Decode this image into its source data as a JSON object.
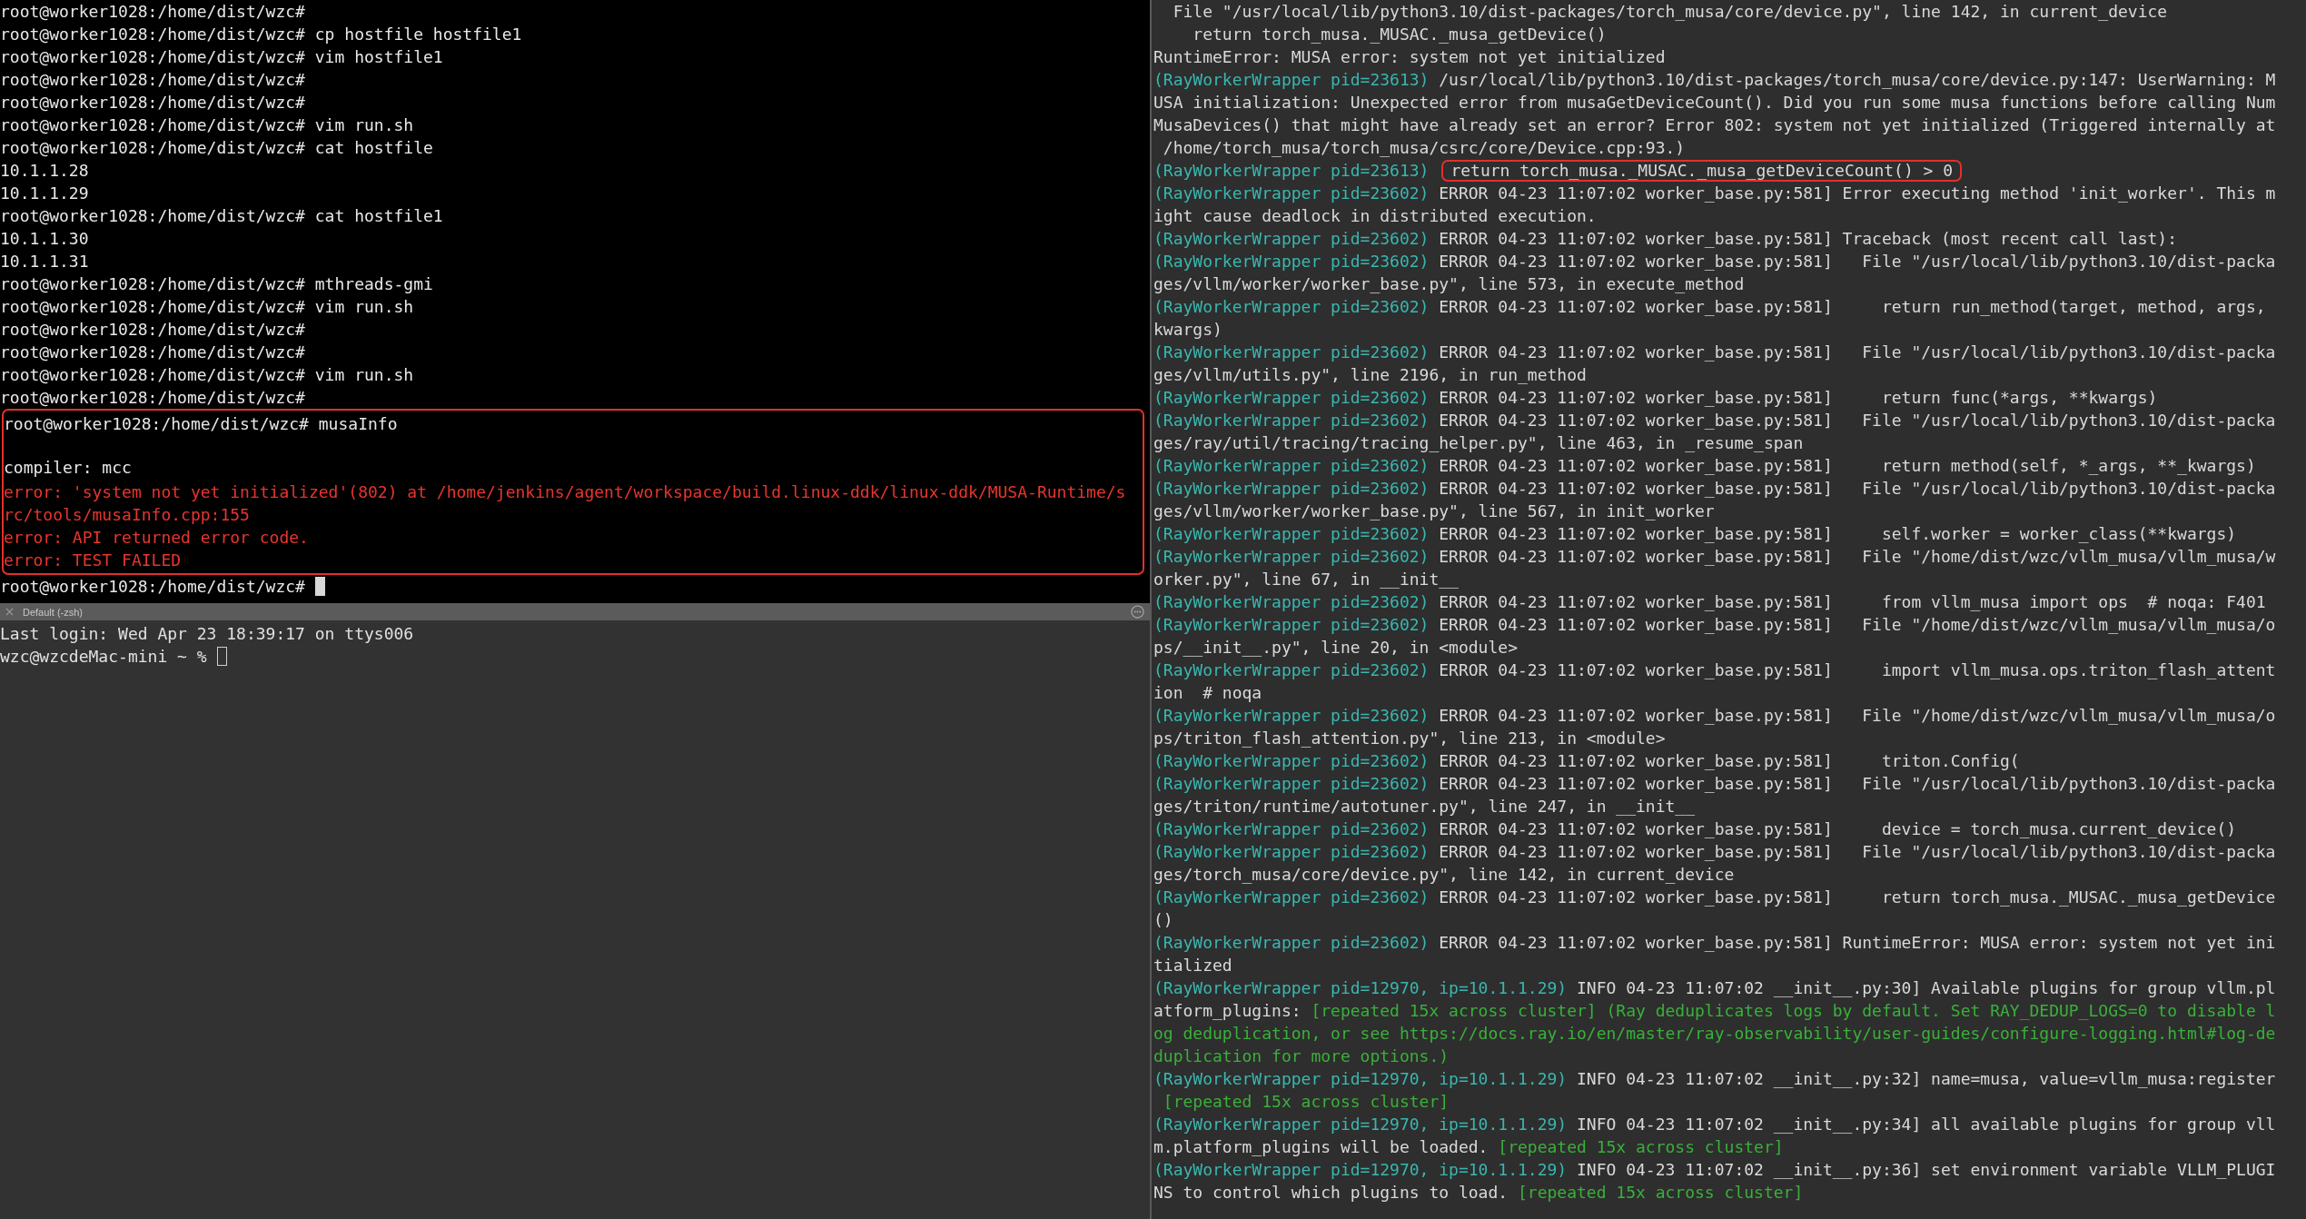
{
  "left": {
    "top_pane": {
      "focused": true,
      "blocks": [
        {
          "highlighted": false,
          "lines": [
            {
              "text": "root@worker1028:/home/dist/wzc#",
              "error": false
            },
            {
              "text": "root@worker1028:/home/dist/wzc# cp hostfile hostfile1",
              "error": false
            },
            {
              "text": "root@worker1028:/home/dist/wzc# vim hostfile1",
              "error": false
            },
            {
              "text": "root@worker1028:/home/dist/wzc#",
              "error": false
            },
            {
              "text": "root@worker1028:/home/dist/wzc#",
              "error": false
            },
            {
              "text": "root@worker1028:/home/dist/wzc# vim run.sh",
              "error": false
            },
            {
              "text": "root@worker1028:/home/dist/wzc# cat hostfile",
              "error": false
            },
            {
              "text": "10.1.1.28",
              "error": false
            },
            {
              "text": "10.1.1.29",
              "error": false
            },
            {
              "text": "root@worker1028:/home/dist/wzc# cat hostfile1",
              "error": false
            },
            {
              "text": "10.1.1.30",
              "error": false
            },
            {
              "text": "10.1.1.31",
              "error": false
            },
            {
              "text": "root@worker1028:/home/dist/wzc# mthreads-gmi",
              "error": false
            },
            {
              "text": "root@worker1028:/home/dist/wzc# vim run.sh",
              "error": false
            },
            {
              "text": "root@worker1028:/home/dist/wzc#",
              "error": false
            },
            {
              "text": "root@worker1028:/home/dist/wzc#",
              "error": false
            },
            {
              "text": "root@worker1028:/home/dist/wzc# vim run.sh",
              "error": false
            },
            {
              "text": "root@worker1028:/home/dist/wzc#",
              "error": false
            }
          ]
        },
        {
          "highlighted": true,
          "lines": [
            {
              "text": "root@worker1028:/home/dist/wzc# musaInfo",
              "error": false
            },
            {
              "text": "compiler: mcc",
              "error": false,
              "blank_line_before": true
            },
            {
              "text": "error: 'system not yet initialized'(802) at /home/jenkins/agent/workspace/build.linux-ddk/linux-ddk/MUSA-Runtime/s",
              "error": true
            },
            {
              "text": "rc/tools/musaInfo.cpp:155",
              "error": true
            },
            {
              "text": "error: API returned error code.",
              "error": true
            },
            {
              "text": "error: TEST FAILED",
              "error": true
            }
          ]
        },
        {
          "highlighted": false,
          "lines": [
            {
              "text": "root@worker1028:/home/dist/wzc#",
              "error": false,
              "cursor": true
            }
          ]
        }
      ]
    },
    "bottom_pane": {
      "focused": false,
      "tab_title": "Default (-zsh)",
      "lines": [
        {
          "text": "Last login: Wed Apr 23 18:39:17 on ttys006",
          "error": false
        },
        {
          "text": "wzc@wzcdeMac-mini ~ %",
          "error": false,
          "cursor": true
        }
      ]
    }
  },
  "right_pane": {
    "rows": [
      [
        {
          "kind": "plain",
          "text": "  File \"/usr/local/lib/python3.10/dist-packages/torch_musa/core/device.py\", line 142, in current_device"
        }
      ],
      [
        {
          "kind": "plain",
          "text": "    return torch_musa._MUSAC._musa_getDevice()"
        }
      ],
      [
        {
          "kind": "plain",
          "text": "RuntimeError: MUSA error: system not yet initialized"
        }
      ],
      [
        {
          "kind": "worker",
          "text": "(RayWorkerWrapper pid=23613)"
        },
        {
          "kind": "plain",
          "text": " /usr/local/lib/python3.10/dist-packages/torch_musa/core/device.py:147: UserWarning: M"
        }
      ],
      [
        {
          "kind": "plain",
          "text": "USA initialization: Unexpected error from musaGetDeviceCount(). Did you run some musa functions before calling Num"
        }
      ],
      [
        {
          "kind": "plain",
          "text": "MusaDevices() that might have already set an error? Error 802: system not yet initialized (Triggered internally at"
        }
      ],
      [
        {
          "kind": "plain",
          "text": " /home/torch_musa/torch_musa/csrc/core/Device.cpp:93.)"
        }
      ],
      [
        {
          "kind": "worker",
          "text": "(RayWorkerWrapper pid=23613)"
        },
        {
          "kind": "boxed",
          "text": "return torch_musa._MUSAC._musa_getDeviceCount() > 0"
        }
      ],
      [
        {
          "kind": "worker",
          "text": "(RayWorkerWrapper pid=23602)"
        },
        {
          "kind": "plain",
          "text": " ERROR 04-23 11:07:02 worker_base.py:581] Error executing method 'init_worker'. This m"
        }
      ],
      [
        {
          "kind": "plain",
          "text": "ight cause deadlock in distributed execution."
        }
      ],
      [
        {
          "kind": "worker",
          "text": "(RayWorkerWrapper pid=23602)"
        },
        {
          "kind": "plain",
          "text": " ERROR 04-23 11:07:02 worker_base.py:581] Traceback (most recent call last):"
        }
      ],
      [
        {
          "kind": "worker",
          "text": "(RayWorkerWrapper pid=23602)"
        },
        {
          "kind": "plain",
          "text": " ERROR 04-23 11:07:02 worker_base.py:581]   File \"/usr/local/lib/python3.10/dist-packa"
        }
      ],
      [
        {
          "kind": "plain",
          "text": "ges/vllm/worker/worker_base.py\", line 573, in execute_method"
        }
      ],
      [
        {
          "kind": "worker",
          "text": "(RayWorkerWrapper pid=23602)"
        },
        {
          "kind": "plain",
          "text": " ERROR 04-23 11:07:02 worker_base.py:581]     return run_method(target, method, args,"
        }
      ],
      [
        {
          "kind": "plain",
          "text": "kwargs)"
        }
      ],
      [
        {
          "kind": "worker",
          "text": "(RayWorkerWrapper pid=23602)"
        },
        {
          "kind": "plain",
          "text": " ERROR 04-23 11:07:02 worker_base.py:581]   File \"/usr/local/lib/python3.10/dist-packa"
        }
      ],
      [
        {
          "kind": "plain",
          "text": "ges/vllm/utils.py\", line 2196, in run_method"
        }
      ],
      [
        {
          "kind": "worker",
          "text": "(RayWorkerWrapper pid=23602)"
        },
        {
          "kind": "plain",
          "text": " ERROR 04-23 11:07:02 worker_base.py:581]     return func(*args, **kwargs)"
        }
      ],
      [
        {
          "kind": "worker",
          "text": "(RayWorkerWrapper pid=23602)"
        },
        {
          "kind": "plain",
          "text": " ERROR 04-23 11:07:02 worker_base.py:581]   File \"/usr/local/lib/python3.10/dist-packa"
        }
      ],
      [
        {
          "kind": "plain",
          "text": "ges/ray/util/tracing/tracing_helper.py\", line 463, in _resume_span"
        }
      ],
      [
        {
          "kind": "worker",
          "text": "(RayWorkerWrapper pid=23602)"
        },
        {
          "kind": "plain",
          "text": " ERROR 04-23 11:07:02 worker_base.py:581]     return method(self, *_args, **_kwargs)"
        }
      ],
      [
        {
          "kind": "worker",
          "text": "(RayWorkerWrapper pid=23602)"
        },
        {
          "kind": "plain",
          "text": " ERROR 04-23 11:07:02 worker_base.py:581]   File \"/usr/local/lib/python3.10/dist-packa"
        }
      ],
      [
        {
          "kind": "plain",
          "text": "ges/vllm/worker/worker_base.py\", line 567, in init_worker"
        }
      ],
      [
        {
          "kind": "worker",
          "text": "(RayWorkerWrapper pid=23602)"
        },
        {
          "kind": "plain",
          "text": " ERROR 04-23 11:07:02 worker_base.py:581]     self.worker = worker_class(**kwargs)"
        }
      ],
      [
        {
          "kind": "worker",
          "text": "(RayWorkerWrapper pid=23602)"
        },
        {
          "kind": "plain",
          "text": " ERROR 04-23 11:07:02 worker_base.py:581]   File \"/home/dist/wzc/vllm_musa/vllm_musa/w"
        }
      ],
      [
        {
          "kind": "plain",
          "text": "orker.py\", line 67, in __init__"
        }
      ],
      [
        {
          "kind": "worker",
          "text": "(RayWorkerWrapper pid=23602)"
        },
        {
          "kind": "plain",
          "text": " ERROR 04-23 11:07:02 worker_base.py:581]     from vllm_musa import ops  # noqa: F401"
        }
      ],
      [
        {
          "kind": "worker",
          "text": "(RayWorkerWrapper pid=23602)"
        },
        {
          "kind": "plain",
          "text": " ERROR 04-23 11:07:02 worker_base.py:581]   File \"/home/dist/wzc/vllm_musa/vllm_musa/o"
        }
      ],
      [
        {
          "kind": "plain",
          "text": "ps/__init__.py\", line 20, in <module>"
        }
      ],
      [
        {
          "kind": "worker",
          "text": "(RayWorkerWrapper pid=23602)"
        },
        {
          "kind": "plain",
          "text": " ERROR 04-23 11:07:02 worker_base.py:581]     import vllm_musa.ops.triton_flash_attent"
        }
      ],
      [
        {
          "kind": "plain",
          "text": "ion  # noqa"
        }
      ],
      [
        {
          "kind": "worker",
          "text": "(RayWorkerWrapper pid=23602)"
        },
        {
          "kind": "plain",
          "text": " ERROR 04-23 11:07:02 worker_base.py:581]   File \"/home/dist/wzc/vllm_musa/vllm_musa/o"
        }
      ],
      [
        {
          "kind": "plain",
          "text": "ps/triton_flash_attention.py\", line 213, in <module>"
        }
      ],
      [
        {
          "kind": "worker",
          "text": "(RayWorkerWrapper pid=23602)"
        },
        {
          "kind": "plain",
          "text": " ERROR 04-23 11:07:02 worker_base.py:581]     triton.Config("
        }
      ],
      [
        {
          "kind": "worker",
          "text": "(RayWorkerWrapper pid=23602)"
        },
        {
          "kind": "plain",
          "text": " ERROR 04-23 11:07:02 worker_base.py:581]   File \"/usr/local/lib/python3.10/dist-packa"
        }
      ],
      [
        {
          "kind": "plain",
          "text": "ges/triton/runtime/autotuner.py\", line 247, in __init__"
        }
      ],
      [
        {
          "kind": "worker",
          "text": "(RayWorkerWrapper pid=23602)"
        },
        {
          "kind": "plain",
          "text": " ERROR 04-23 11:07:02 worker_base.py:581]     device = torch_musa.current_device()"
        }
      ],
      [
        {
          "kind": "worker",
          "text": "(RayWorkerWrapper pid=23602)"
        },
        {
          "kind": "plain",
          "text": " ERROR 04-23 11:07:02 worker_base.py:581]   File \"/usr/local/lib/python3.10/dist-packa"
        }
      ],
      [
        {
          "kind": "plain",
          "text": "ges/torch_musa/core/device.py\", line 142, in current_device"
        }
      ],
      [
        {
          "kind": "worker",
          "text": "(RayWorkerWrapper pid=23602)"
        },
        {
          "kind": "plain",
          "text": " ERROR 04-23 11:07:02 worker_base.py:581]     return torch_musa._MUSAC._musa_getDevice"
        }
      ],
      [
        {
          "kind": "plain",
          "text": "()"
        }
      ],
      [
        {
          "kind": "worker",
          "text": "(RayWorkerWrapper pid=23602)"
        },
        {
          "kind": "plain",
          "text": " ERROR 04-23 11:07:02 worker_base.py:581] RuntimeError: MUSA error: system not yet ini"
        }
      ],
      [
        {
          "kind": "plain",
          "text": "tialized"
        }
      ],
      [
        {
          "kind": "worker",
          "text": "(RayWorkerWrapper pid=12970, ip=10.1.1.29)"
        },
        {
          "kind": "plain",
          "text": " INFO 04-23 11:07:02 __init__.py:30] Available plugins for group vllm.pl"
        }
      ],
      [
        {
          "kind": "plain",
          "text": "atform_plugins: "
        },
        {
          "kind": "note",
          "text": "[repeated 15x across cluster] (Ray deduplicates logs by default. Set RAY_DEDUP_LOGS=0 to disable l"
        }
      ],
      [
        {
          "kind": "note",
          "text": "og deduplication, or see https://docs.ray.io/en/master/ray-observability/user-guides/configure-logging.html#log-de"
        }
      ],
      [
        {
          "kind": "note",
          "text": "duplication for more options.)"
        }
      ],
      [
        {
          "kind": "worker",
          "text": "(RayWorkerWrapper pid=12970, ip=10.1.1.29)"
        },
        {
          "kind": "plain",
          "text": " INFO 04-23 11:07:02 __init__.py:32] name=musa, value=vllm_musa:register"
        }
      ],
      [
        {
          "kind": "note",
          "text": " [repeated 15x across cluster]"
        }
      ],
      [
        {
          "kind": "worker",
          "text": "(RayWorkerWrapper pid=12970, ip=10.1.1.29)"
        },
        {
          "kind": "plain",
          "text": " INFO 04-23 11:07:02 __init__.py:34] all available plugins for group vll"
        }
      ],
      [
        {
          "kind": "plain",
          "text": "m.platform_plugins will be loaded. "
        },
        {
          "kind": "note",
          "text": "[repeated 15x across cluster]"
        }
      ],
      [
        {
          "kind": "worker",
          "text": "(RayWorkerWrapper pid=12970, ip=10.1.1.29)"
        },
        {
          "kind": "plain",
          "text": " INFO 04-23 11:07:02 __init__.py:36] set environment variable VLLM_PLUGI"
        }
      ],
      [
        {
          "kind": "plain",
          "text": "NS to control which plugins to load. "
        },
        {
          "kind": "note",
          "text": "[repeated 15x across cluster]"
        }
      ]
    ]
  }
}
